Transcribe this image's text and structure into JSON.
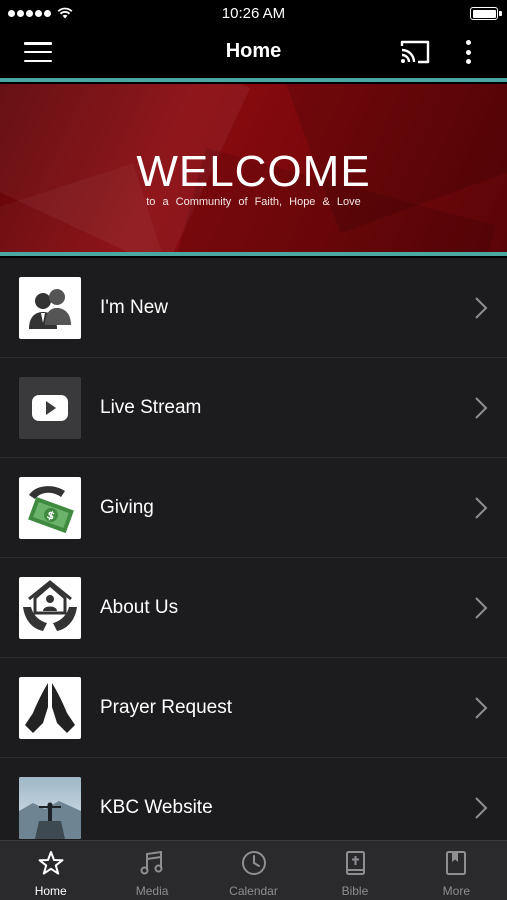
{
  "status": {
    "time": "10:26 AM"
  },
  "nav": {
    "title": "Home"
  },
  "banner": {
    "title": "WELCOME",
    "subtitle": "to a Community of Faith, Hope & Love"
  },
  "menu": {
    "items": [
      {
        "label": "I'm New",
        "icon": "people-icon"
      },
      {
        "label": "Live Stream",
        "icon": "youtube-play-icon"
      },
      {
        "label": "Giving",
        "icon": "money-hand-icon"
      },
      {
        "label": "About Us",
        "icon": "house-hands-icon"
      },
      {
        "label": "Prayer Request",
        "icon": "praying-hands-icon"
      },
      {
        "label": "KBC Website",
        "icon": "website-photo-icon"
      }
    ]
  },
  "tabs": [
    {
      "label": "Home",
      "icon": "star-icon",
      "active": true
    },
    {
      "label": "Media",
      "icon": "music-note-icon",
      "active": false
    },
    {
      "label": "Calendar",
      "icon": "clock-icon",
      "active": false
    },
    {
      "label": "Bible",
      "icon": "bible-icon",
      "active": false
    },
    {
      "label": "More",
      "icon": "bookmark-book-icon",
      "active": false
    }
  ],
  "colors": {
    "accent_teal": "#4aa7a2",
    "banner_red": "#8a0b10",
    "list_bg": "#1c1c1e",
    "tab_bg": "#2a2a2c",
    "tab_inactive": "#8e8e93"
  }
}
